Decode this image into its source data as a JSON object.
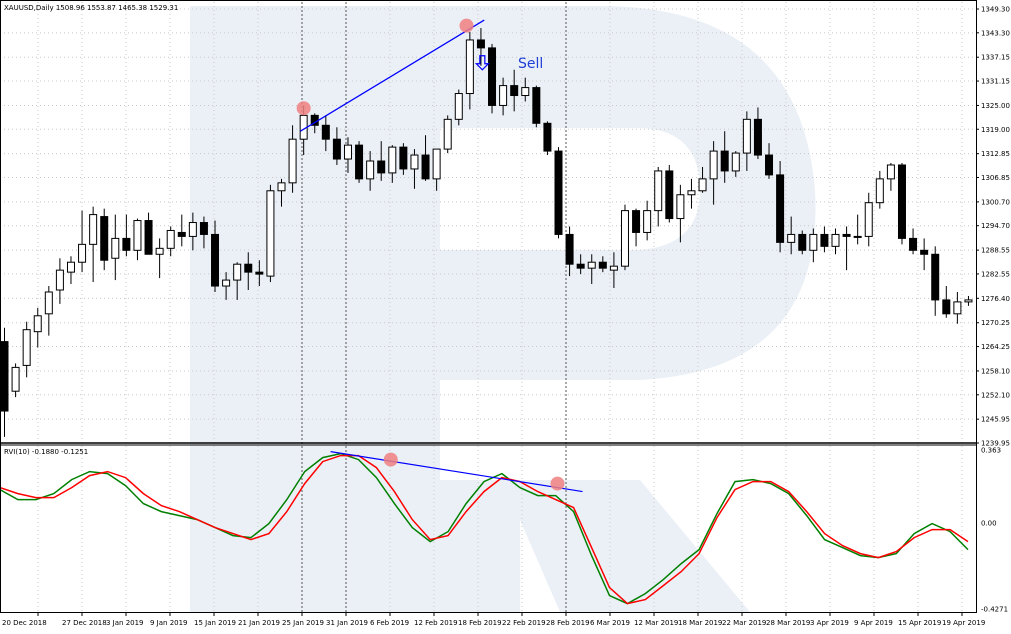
{
  "header": {
    "main": "XAUUSD,Daily  1508.96 1553.87 1465.38 1529.31",
    "rvi": "RVI(10) -0.1880 -0.1251"
  },
  "annotations": {
    "sell": "Sell"
  },
  "colors": {
    "bull_body": "#ffffff",
    "bear_body": "#000000",
    "trendline": "#0000ff",
    "rvi_main": "#008000",
    "rvi_signal": "#ff0000",
    "marker": "#f08080",
    "watermark": "#e8edf6"
  },
  "chart_data": [
    {
      "type": "candlestick",
      "symbol": "XAUUSD",
      "timeframe": "Daily",
      "ylim": [
        1239.95,
        1349.3
      ],
      "y_ticks": [
        "1349.30",
        "1343.30",
        "1337.15",
        "1331.15",
        "1325.00",
        "1319.00",
        "1312.85",
        "1306.85",
        "1300.70",
        "1294.70",
        "1288.55",
        "1282.55",
        "1276.40",
        "1270.25",
        "1264.25",
        "1258.10",
        "1252.10",
        "1245.95",
        "1239.95"
      ],
      "x_ticks": [
        "20 Dec 2018",
        "27 Dec 2018",
        "3 Jan 2019",
        "9 Jan 2019",
        "15 Jan 2019",
        "21 Jan 2019",
        "25 Jan 2019",
        "31 Jan 2019",
        "6 Feb 2019",
        "12 Feb 2019",
        "18 Feb 2019",
        "22 Feb 2019",
        "28 Feb 2019",
        "6 Mar 2019",
        "12 Mar 2019",
        "18 Mar 2019",
        "22 Mar 2019",
        "28 Mar 2019",
        "3 Apr 2019",
        "9 Apr 2019",
        "15 Apr 2019",
        "19 Apr 2019"
      ],
      "candles": [
        [
          1265.5,
          1269.0,
          1241.5,
          1248.0
        ],
        [
          1253.0,
          1260.0,
          1251.5,
          1259.0
        ],
        [
          1259.5,
          1270.5,
          1256.5,
          1268.5
        ],
        [
          1268.0,
          1274.0,
          1264.0,
          1272.0
        ],
        [
          1272.5,
          1279.5,
          1267.0,
          1278.0
        ],
        [
          1278.5,
          1286.5,
          1275.0,
          1283.5
        ],
        [
          1283.0,
          1287.0,
          1280.0,
          1285.5
        ],
        [
          1285.5,
          1298.5,
          1283.0,
          1290.0
        ],
        [
          1290.0,
          1299.5,
          1280.5,
          1297.5
        ],
        [
          1297.0,
          1299.0,
          1283.5,
          1286.0
        ],
        [
          1286.5,
          1297.5,
          1281.0,
          1291.5
        ],
        [
          1291.5,
          1297.5,
          1287.0,
          1288.5
        ],
        [
          1288.5,
          1296.5,
          1286.0,
          1296.0
        ],
        [
          1296.0,
          1298.0,
          1288.0,
          1287.5
        ],
        [
          1287.5,
          1291.5,
          1281.5,
          1289.0
        ],
        [
          1289.0,
          1294.5,
          1287.0,
          1293.5
        ],
        [
          1293.0,
          1297.5,
          1289.5,
          1292.0
        ],
        [
          1292.0,
          1298.0,
          1288.5,
          1295.5
        ],
        [
          1295.5,
          1297.0,
          1289.0,
          1292.5
        ],
        [
          1292.5,
          1296.0,
          1278.0,
          1279.5
        ],
        [
          1279.5,
          1283.0,
          1276.0,
          1281.0
        ],
        [
          1281.0,
          1285.5,
          1276.0,
          1285.0
        ],
        [
          1285.0,
          1288.0,
          1278.5,
          1283.0
        ],
        [
          1283.0,
          1286.0,
          1279.5,
          1282.5
        ],
        [
          1282.0,
          1305.0,
          1280.5,
          1303.5
        ],
        [
          1303.5,
          1306.5,
          1299.5,
          1305.5
        ],
        [
          1305.5,
          1320.0,
          1303.0,
          1316.5
        ],
        [
          1316.5,
          1325.0,
          1312.5,
          1322.5
        ],
        [
          1322.5,
          1323.0,
          1318.0,
          1320.0
        ],
        [
          1320.0,
          1322.5,
          1313.5,
          1316.5
        ],
        [
          1316.5,
          1319.5,
          1310.0,
          1311.5
        ],
        [
          1311.5,
          1317.0,
          1308.0,
          1315.0
        ],
        [
          1315.0,
          1316.0,
          1305.5,
          1306.5
        ],
        [
          1306.5,
          1313.5,
          1303.5,
          1311.0
        ],
        [
          1311.0,
          1316.0,
          1306.0,
          1308.0
        ],
        [
          1308.0,
          1315.0,
          1305.5,
          1314.5
        ],
        [
          1314.5,
          1315.5,
          1307.5,
          1309.0
        ],
        [
          1309.0,
          1314.0,
          1304.0,
          1312.5
        ],
        [
          1312.5,
          1317.5,
          1306.0,
          1306.5
        ],
        [
          1306.5,
          1314.0,
          1303.5,
          1314.0
        ],
        [
          1314.0,
          1322.5,
          1313.0,
          1321.5
        ],
        [
          1321.5,
          1329.0,
          1320.0,
          1328.0
        ],
        [
          1328.0,
          1343.5,
          1324.0,
          1341.5
        ],
        [
          1341.5,
          1344.5,
          1335.0,
          1339.5
        ],
        [
          1339.5,
          1340.5,
          1323.0,
          1325.0
        ],
        [
          1325.0,
          1332.0,
          1322.5,
          1330.0
        ],
        [
          1330.0,
          1334.0,
          1323.5,
          1327.5
        ],
        [
          1327.5,
          1332.0,
          1326.0,
          1329.5
        ],
        [
          1329.5,
          1330.0,
          1319.5,
          1320.5
        ],
        [
          1320.5,
          1321.0,
          1312.5,
          1313.5
        ],
        [
          1313.5,
          1314.5,
          1291.5,
          1292.5
        ],
        [
          1292.5,
          1294.5,
          1282.0,
          1285.0
        ],
        [
          1285.0,
          1287.5,
          1282.5,
          1284.0
        ],
        [
          1284.0,
          1287.5,
          1280.0,
          1285.5
        ],
        [
          1285.5,
          1287.0,
          1283.0,
          1284.0
        ],
        [
          1283.5,
          1288.0,
          1279.0,
          1284.5
        ],
        [
          1284.5,
          1300.0,
          1283.5,
          1298.5
        ],
        [
          1298.5,
          1299.0,
          1289.5,
          1293.0
        ],
        [
          1293.0,
          1301.0,
          1291.0,
          1298.5
        ],
        [
          1298.5,
          1309.5,
          1294.5,
          1308.5
        ],
        [
          1308.5,
          1310.0,
          1295.5,
          1296.5
        ],
        [
          1296.5,
          1305.0,
          1290.5,
          1302.5
        ],
        [
          1302.5,
          1306.5,
          1299.0,
          1303.5
        ],
        [
          1303.5,
          1309.5,
          1303.0,
          1306.5
        ],
        [
          1306.5,
          1316.0,
          1300.0,
          1313.5
        ],
        [
          1313.5,
          1318.5,
          1305.5,
          1308.5
        ],
        [
          1308.5,
          1313.5,
          1307.0,
          1313.0
        ],
        [
          1313.0,
          1323.5,
          1308.5,
          1321.5
        ],
        [
          1321.5,
          1324.5,
          1311.5,
          1312.5
        ],
        [
          1312.5,
          1315.5,
          1306.5,
          1307.5
        ],
        [
          1307.5,
          1311.0,
          1288.0,
          1290.5
        ],
        [
          1290.5,
          1297.0,
          1287.5,
          1292.5
        ],
        [
          1292.5,
          1293.5,
          1287.5,
          1288.5
        ],
        [
          1288.5,
          1294.0,
          1285.5,
          1292.5
        ],
        [
          1292.5,
          1294.5,
          1288.0,
          1289.5
        ],
        [
          1289.5,
          1294.0,
          1287.5,
          1292.5
        ],
        [
          1292.5,
          1294.5,
          1283.5,
          1292.0
        ],
        [
          1292.0,
          1297.5,
          1290.0,
          1292.0
        ],
        [
          1292.0,
          1303.0,
          1289.5,
          1300.5
        ],
        [
          1300.5,
          1308.5,
          1299.0,
          1306.5
        ],
        [
          1306.5,
          1310.5,
          1303.5,
          1310.0
        ],
        [
          1310.0,
          1310.5,
          1290.0,
          1291.5
        ],
        [
          1291.5,
          1294.0,
          1287.5,
          1288.5
        ],
        [
          1288.5,
          1291.5,
          1283.5,
          1287.5
        ],
        [
          1287.5,
          1289.5,
          1272.0,
          1276.0
        ],
        [
          1276.0,
          1279.5,
          1271.5,
          1272.5
        ],
        [
          1272.5,
          1278.0,
          1270.0,
          1275.5
        ],
        [
          1275.5,
          1277.0,
          1274.5,
          1276.0
        ]
      ],
      "annotations": [
        {
          "type": "trendline",
          "from": [
            26.7,
            1318.5
          ],
          "to": [
            43.3,
            1346.5
          ]
        },
        {
          "type": "marker",
          "x": 27,
          "y": 1324.3
        },
        {
          "type": "marker",
          "x": 41.7,
          "y": 1345.1
        },
        {
          "type": "arrow-down-label",
          "x": 44.3,
          "y": 1335.0,
          "label": "Sell"
        }
      ],
      "vertical_dashed_at_x_ticks": [
        "25 Jan 2019",
        "31 Jan 2019",
        "28 Feb 2019"
      ]
    },
    {
      "type": "line",
      "name": "RVI(10)",
      "ylim": [
        -0.4271,
        0.363
      ],
      "y_ticks": [
        "0.363",
        "0.00",
        "-0.4271"
      ],
      "series": [
        {
          "color": "#008000",
          "values": [
            0.17,
            0.12,
            0.12,
            0.15,
            0.22,
            0.26,
            0.25,
            0.19,
            0.1,
            0.06,
            0.04,
            0.02,
            -0.02,
            -0.06,
            -0.07,
            0.0,
            0.12,
            0.26,
            0.33,
            0.35,
            0.32,
            0.23,
            0.1,
            -0.02,
            -0.09,
            -0.04,
            0.1,
            0.21,
            0.25,
            0.18,
            0.14,
            0.14,
            0.06,
            -0.16,
            -0.36,
            -0.4,
            -0.35,
            -0.28,
            -0.2,
            -0.13,
            0.05,
            0.21,
            0.22,
            0.2,
            0.15,
            0.04,
            -0.08,
            -0.12,
            -0.16,
            -0.17,
            -0.15,
            -0.05,
            0.0,
            -0.04,
            -0.13
          ]
        },
        {
          "color": "#ff0000",
          "values": [
            0.18,
            0.15,
            0.13,
            0.13,
            0.18,
            0.24,
            0.26,
            0.23,
            0.15,
            0.09,
            0.06,
            0.02,
            -0.02,
            -0.05,
            -0.08,
            -0.05,
            0.06,
            0.2,
            0.31,
            0.34,
            0.34,
            0.28,
            0.16,
            0.02,
            -0.08,
            -0.06,
            0.06,
            0.16,
            0.23,
            0.21,
            0.16,
            0.12,
            0.08,
            -0.12,
            -0.32,
            -0.4,
            -0.38,
            -0.31,
            -0.24,
            -0.15,
            0.03,
            0.17,
            0.21,
            0.21,
            0.16,
            0.06,
            -0.05,
            -0.11,
            -0.15,
            -0.17,
            -0.14,
            -0.07,
            -0.03,
            -0.03,
            -0.09
          ]
        }
      ],
      "annotations": [
        {
          "type": "trendline",
          "from": [
            18.6,
            0.36
          ],
          "to": [
            34.3,
            0.16
          ]
        },
        {
          "type": "marker",
          "x": 21.8,
          "y": 0.32
        },
        {
          "type": "marker",
          "x": 31.1,
          "y": 0.2
        }
      ]
    }
  ]
}
